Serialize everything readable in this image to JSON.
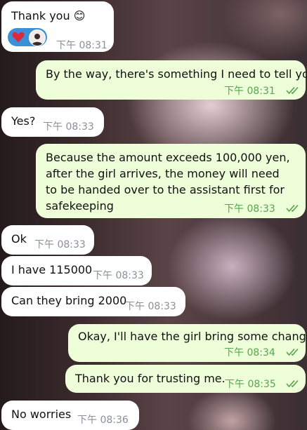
{
  "messages": [
    {
      "direction": "incoming",
      "text": "Thank you 😊",
      "time": "下午 08:31"
    },
    {
      "direction": "outgoing",
      "text": "By the way, there's something I need to tell you.",
      "time": "下午 08:31",
      "status": "read"
    },
    {
      "direction": "incoming",
      "text": "Yes?",
      "time": "下午 08:33"
    },
    {
      "direction": "outgoing",
      "text": "Because the amount exceeds 100,000 yen, after the girl arrives, the money will need to be handed over to the assistant first for safekeeping",
      "time": "下午 08:33",
      "status": "read"
    },
    {
      "direction": "incoming",
      "text": "Ok",
      "time": "下午 08:33"
    },
    {
      "direction": "incoming",
      "text": "I have 115000",
      "time": "下午 08:33"
    },
    {
      "direction": "incoming",
      "text": "Can they bring 2000",
      "time": "下午 08:33"
    },
    {
      "direction": "outgoing",
      "text": "Okay, I'll have the girl bring some change.",
      "time": "下午 08:34",
      "status": "read"
    },
    {
      "direction": "outgoing",
      "text": "Thank you for trusting me.",
      "time": "下午 08:35",
      "status": "read"
    },
    {
      "direction": "incoming",
      "text": "No worries",
      "time": "下午 08:36"
    }
  ],
  "reaction": {
    "emoji": "heart",
    "reactor": "avatar"
  },
  "colors": {
    "incoming": "#ffffff",
    "outgoing": "#eefed9",
    "time_incoming": "#8a9099",
    "time_outgoing": "#5aa54f",
    "reaction_pill": "#3d8fd6",
    "heart": "#e0263a"
  }
}
